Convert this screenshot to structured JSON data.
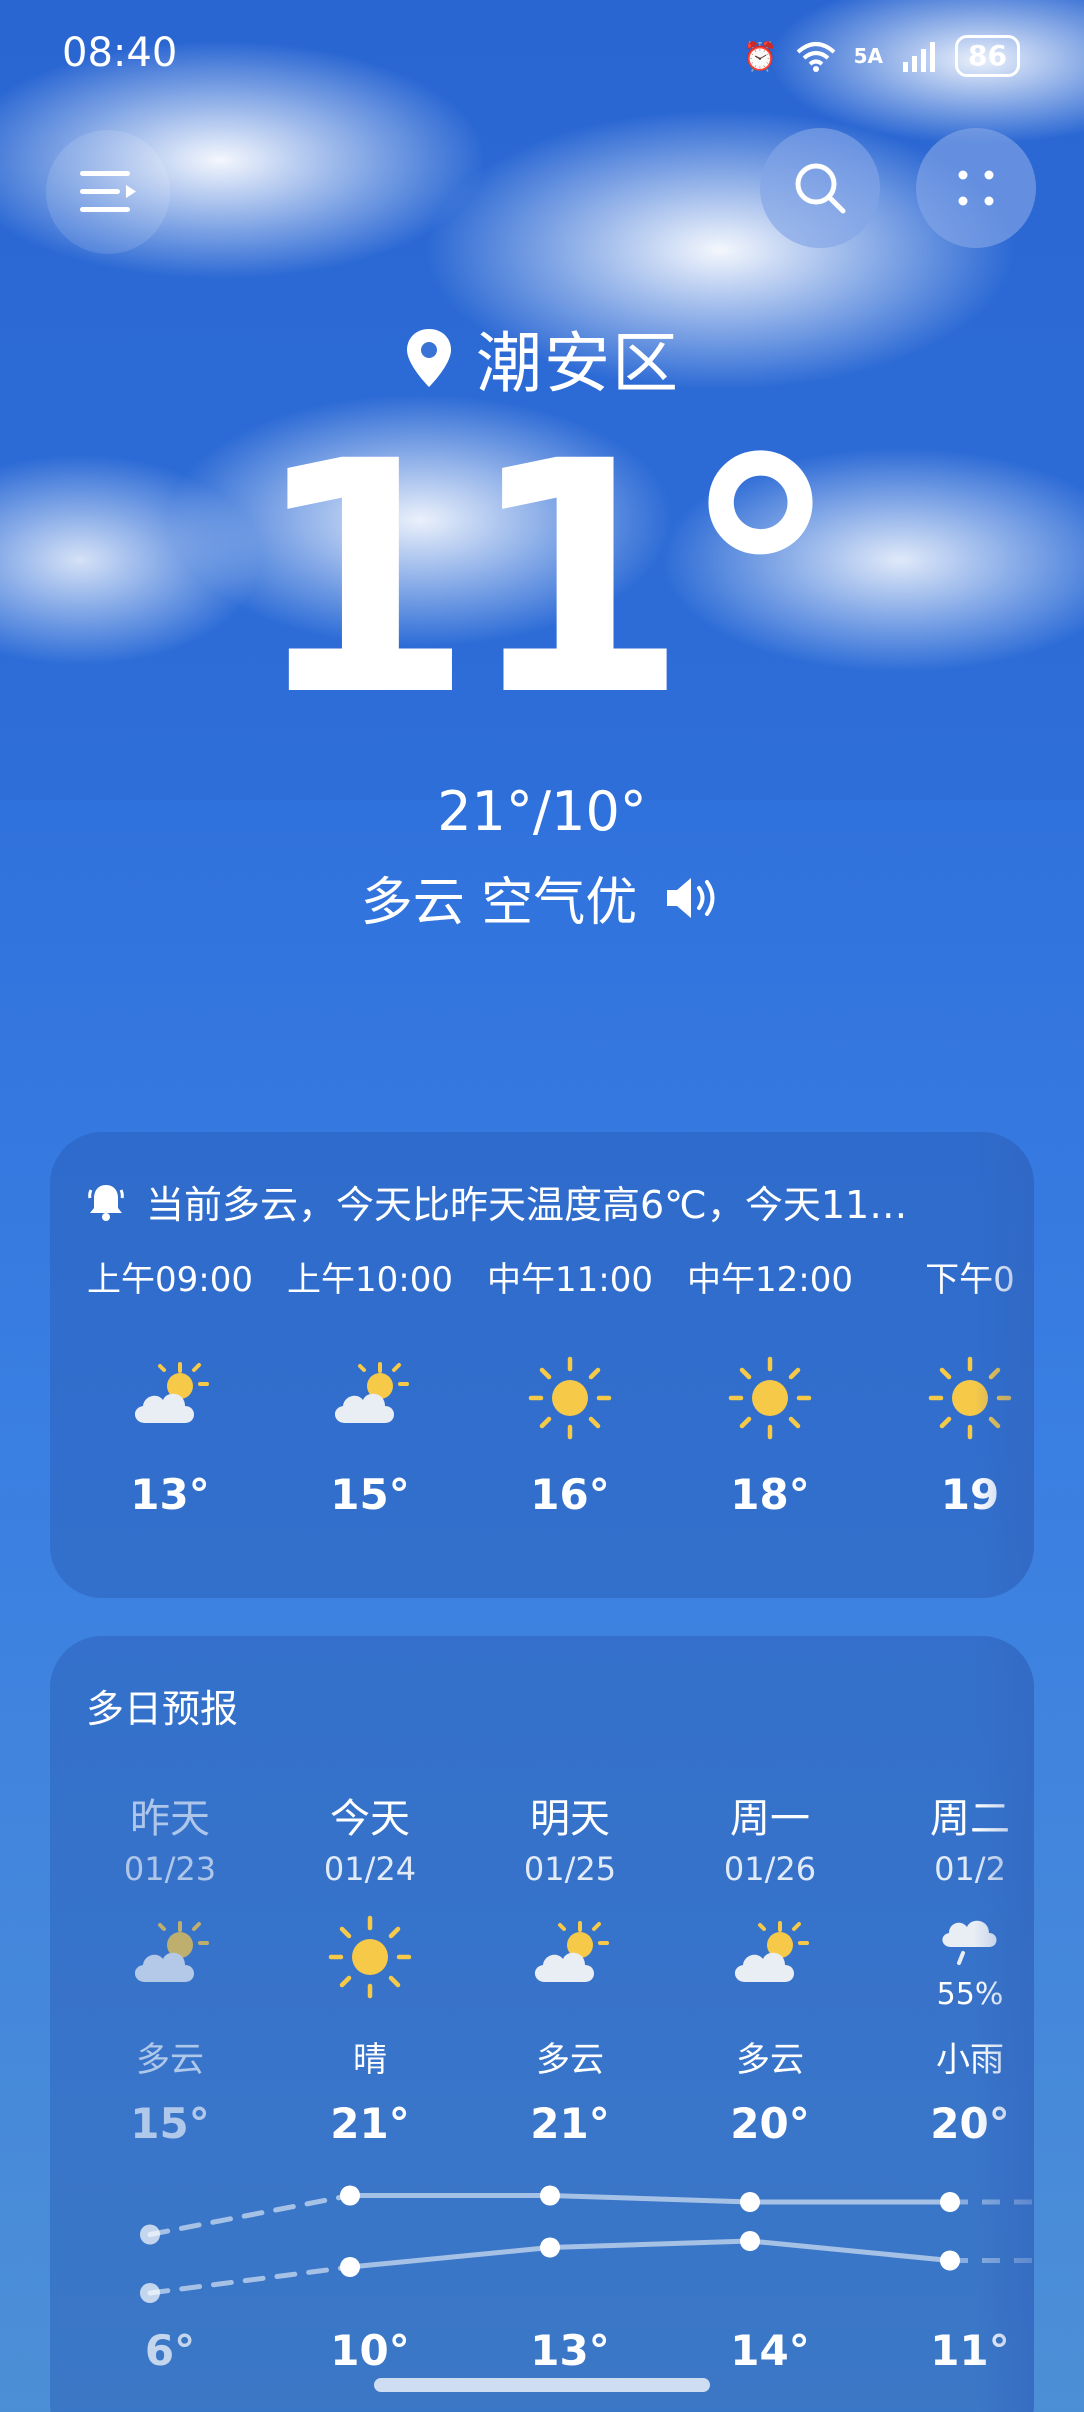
{
  "status": {
    "time": "08:40",
    "network": "5A",
    "battery": "86"
  },
  "header": {
    "location": "潮安区",
    "temperature": "11°",
    "high_low": "21°/10°",
    "condition": "多云 空气优"
  },
  "hourly": {
    "alert": "当前多云，今天比昨天温度高6℃，今天11…",
    "items": [
      {
        "time": "上午09:00",
        "icon": "partly-cloudy-icon",
        "temp": "13°"
      },
      {
        "time": "上午10:00",
        "icon": "partly-cloudy-icon",
        "temp": "15°"
      },
      {
        "time": "中午11:00",
        "icon": "sunny-icon",
        "temp": "16°"
      },
      {
        "time": "中午12:00",
        "icon": "sunny-icon",
        "temp": "18°"
      },
      {
        "time": "下午0",
        "icon": "sunny-icon",
        "temp": "19"
      }
    ]
  },
  "daily": {
    "title": "多日预报",
    "items": [
      {
        "day": "昨天",
        "date": "01/23",
        "icon": "partly-cloudy-icon",
        "condition": "多云",
        "high": "15°",
        "low": "6°",
        "high_value": 15,
        "low_value": 6
      },
      {
        "day": "今天",
        "date": "01/24",
        "icon": "sunny-icon",
        "condition": "晴",
        "high": "21°",
        "low": "10°",
        "high_value": 21,
        "low_value": 10
      },
      {
        "day": "明天",
        "date": "01/25",
        "icon": "partly-cloudy-icon",
        "condition": "多云",
        "high": "21°",
        "low": "13°",
        "high_value": 21,
        "low_value": 13
      },
      {
        "day": "周一",
        "date": "01/26",
        "icon": "partly-cloudy-icon",
        "condition": "多云",
        "high": "20°",
        "low": "14°",
        "high_value": 20,
        "low_value": 14
      },
      {
        "day": "周二",
        "date": "01/2",
        "icon": "light-rain-icon",
        "precip": "55%",
        "condition": "小雨",
        "high": "20°",
        "low": "11°",
        "high_value": 20,
        "low_value": 11
      }
    ]
  },
  "colors": {
    "sun": "#f7c948",
    "cloud": "#e9eef5"
  }
}
